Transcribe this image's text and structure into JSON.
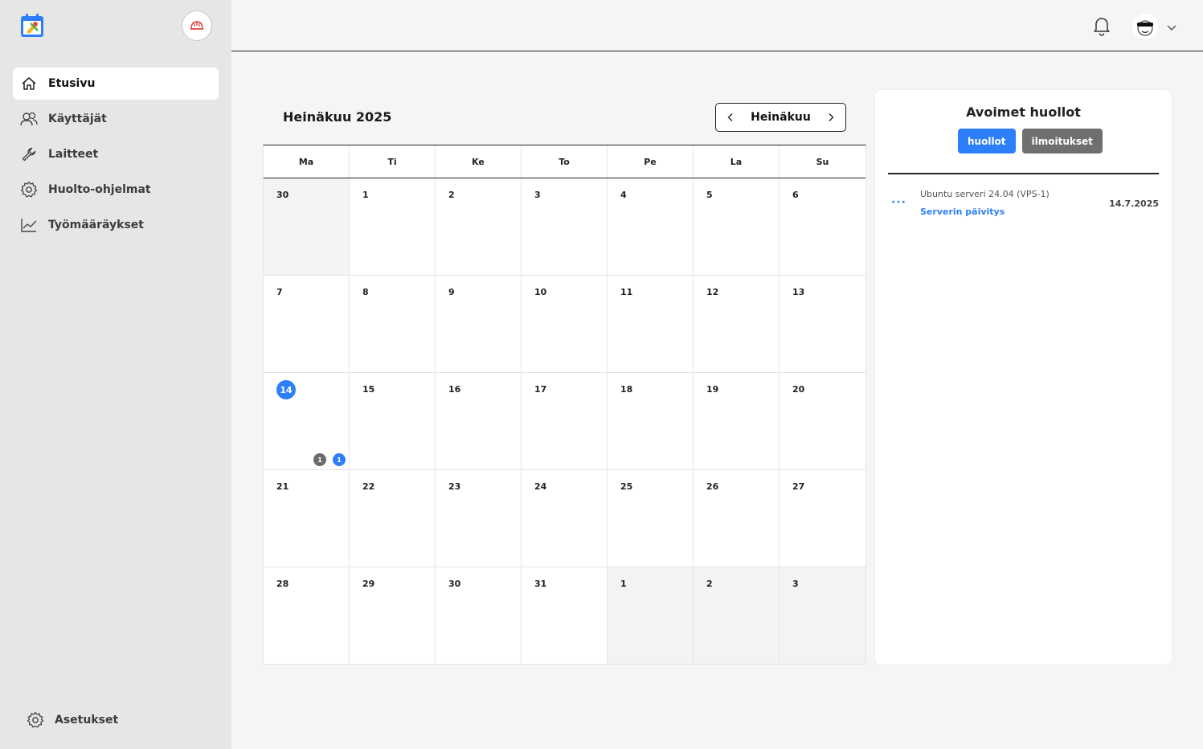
{
  "sidebar": {
    "items": [
      {
        "label": "Etusivu",
        "icon": "home-icon",
        "active": true
      },
      {
        "label": "Käyttäjät",
        "icon": "users-icon",
        "active": false
      },
      {
        "label": "Laitteet",
        "icon": "wrench-icon",
        "active": false
      },
      {
        "label": "Huolto-ohjelmat",
        "icon": "gear-icon",
        "active": false
      },
      {
        "label": "Työmääräykset",
        "icon": "chart-line-icon",
        "active": false
      }
    ],
    "settings_label": "Asetukset"
  },
  "calendar": {
    "title": "Heinäkuu 2025",
    "month_label": "Heinäkuu",
    "weekdays": [
      "Ma",
      "Ti",
      "Ke",
      "To",
      "Pe",
      "La",
      "Su"
    ],
    "days": [
      {
        "n": "30",
        "other": true
      },
      {
        "n": "1"
      },
      {
        "n": "2"
      },
      {
        "n": "3"
      },
      {
        "n": "4"
      },
      {
        "n": "5"
      },
      {
        "n": "6"
      },
      {
        "n": "7"
      },
      {
        "n": "8"
      },
      {
        "n": "9"
      },
      {
        "n": "10"
      },
      {
        "n": "11"
      },
      {
        "n": "12"
      },
      {
        "n": "13"
      },
      {
        "n": "14",
        "today": true,
        "badges": [
          {
            "count": "1",
            "color": "gray"
          },
          {
            "count": "1",
            "color": "blue"
          }
        ]
      },
      {
        "n": "15"
      },
      {
        "n": "16"
      },
      {
        "n": "17"
      },
      {
        "n": "18"
      },
      {
        "n": "19"
      },
      {
        "n": "20"
      },
      {
        "n": "21"
      },
      {
        "n": "22"
      },
      {
        "n": "23"
      },
      {
        "n": "24"
      },
      {
        "n": "25"
      },
      {
        "n": "26"
      },
      {
        "n": "27"
      },
      {
        "n": "28"
      },
      {
        "n": "29"
      },
      {
        "n": "30"
      },
      {
        "n": "31"
      },
      {
        "n": "1",
        "other": true
      },
      {
        "n": "2",
        "other": true
      },
      {
        "n": "3",
        "other": true
      }
    ]
  },
  "panel": {
    "title": "Avoimet huollot",
    "tabs": [
      {
        "label": "huollot",
        "color": "blue"
      },
      {
        "label": "ilmoitukset",
        "color": "gray"
      }
    ],
    "items": [
      {
        "device": "Ubuntu serveri 24.04 (VPS-1)",
        "task": "Serverin päivitys",
        "date": "14.7.2025"
      }
    ]
  },
  "colors": {
    "accent": "#2d7ff9",
    "sidebar_bg": "#e6e6e4",
    "badge_gray": "#6b6b6b"
  }
}
